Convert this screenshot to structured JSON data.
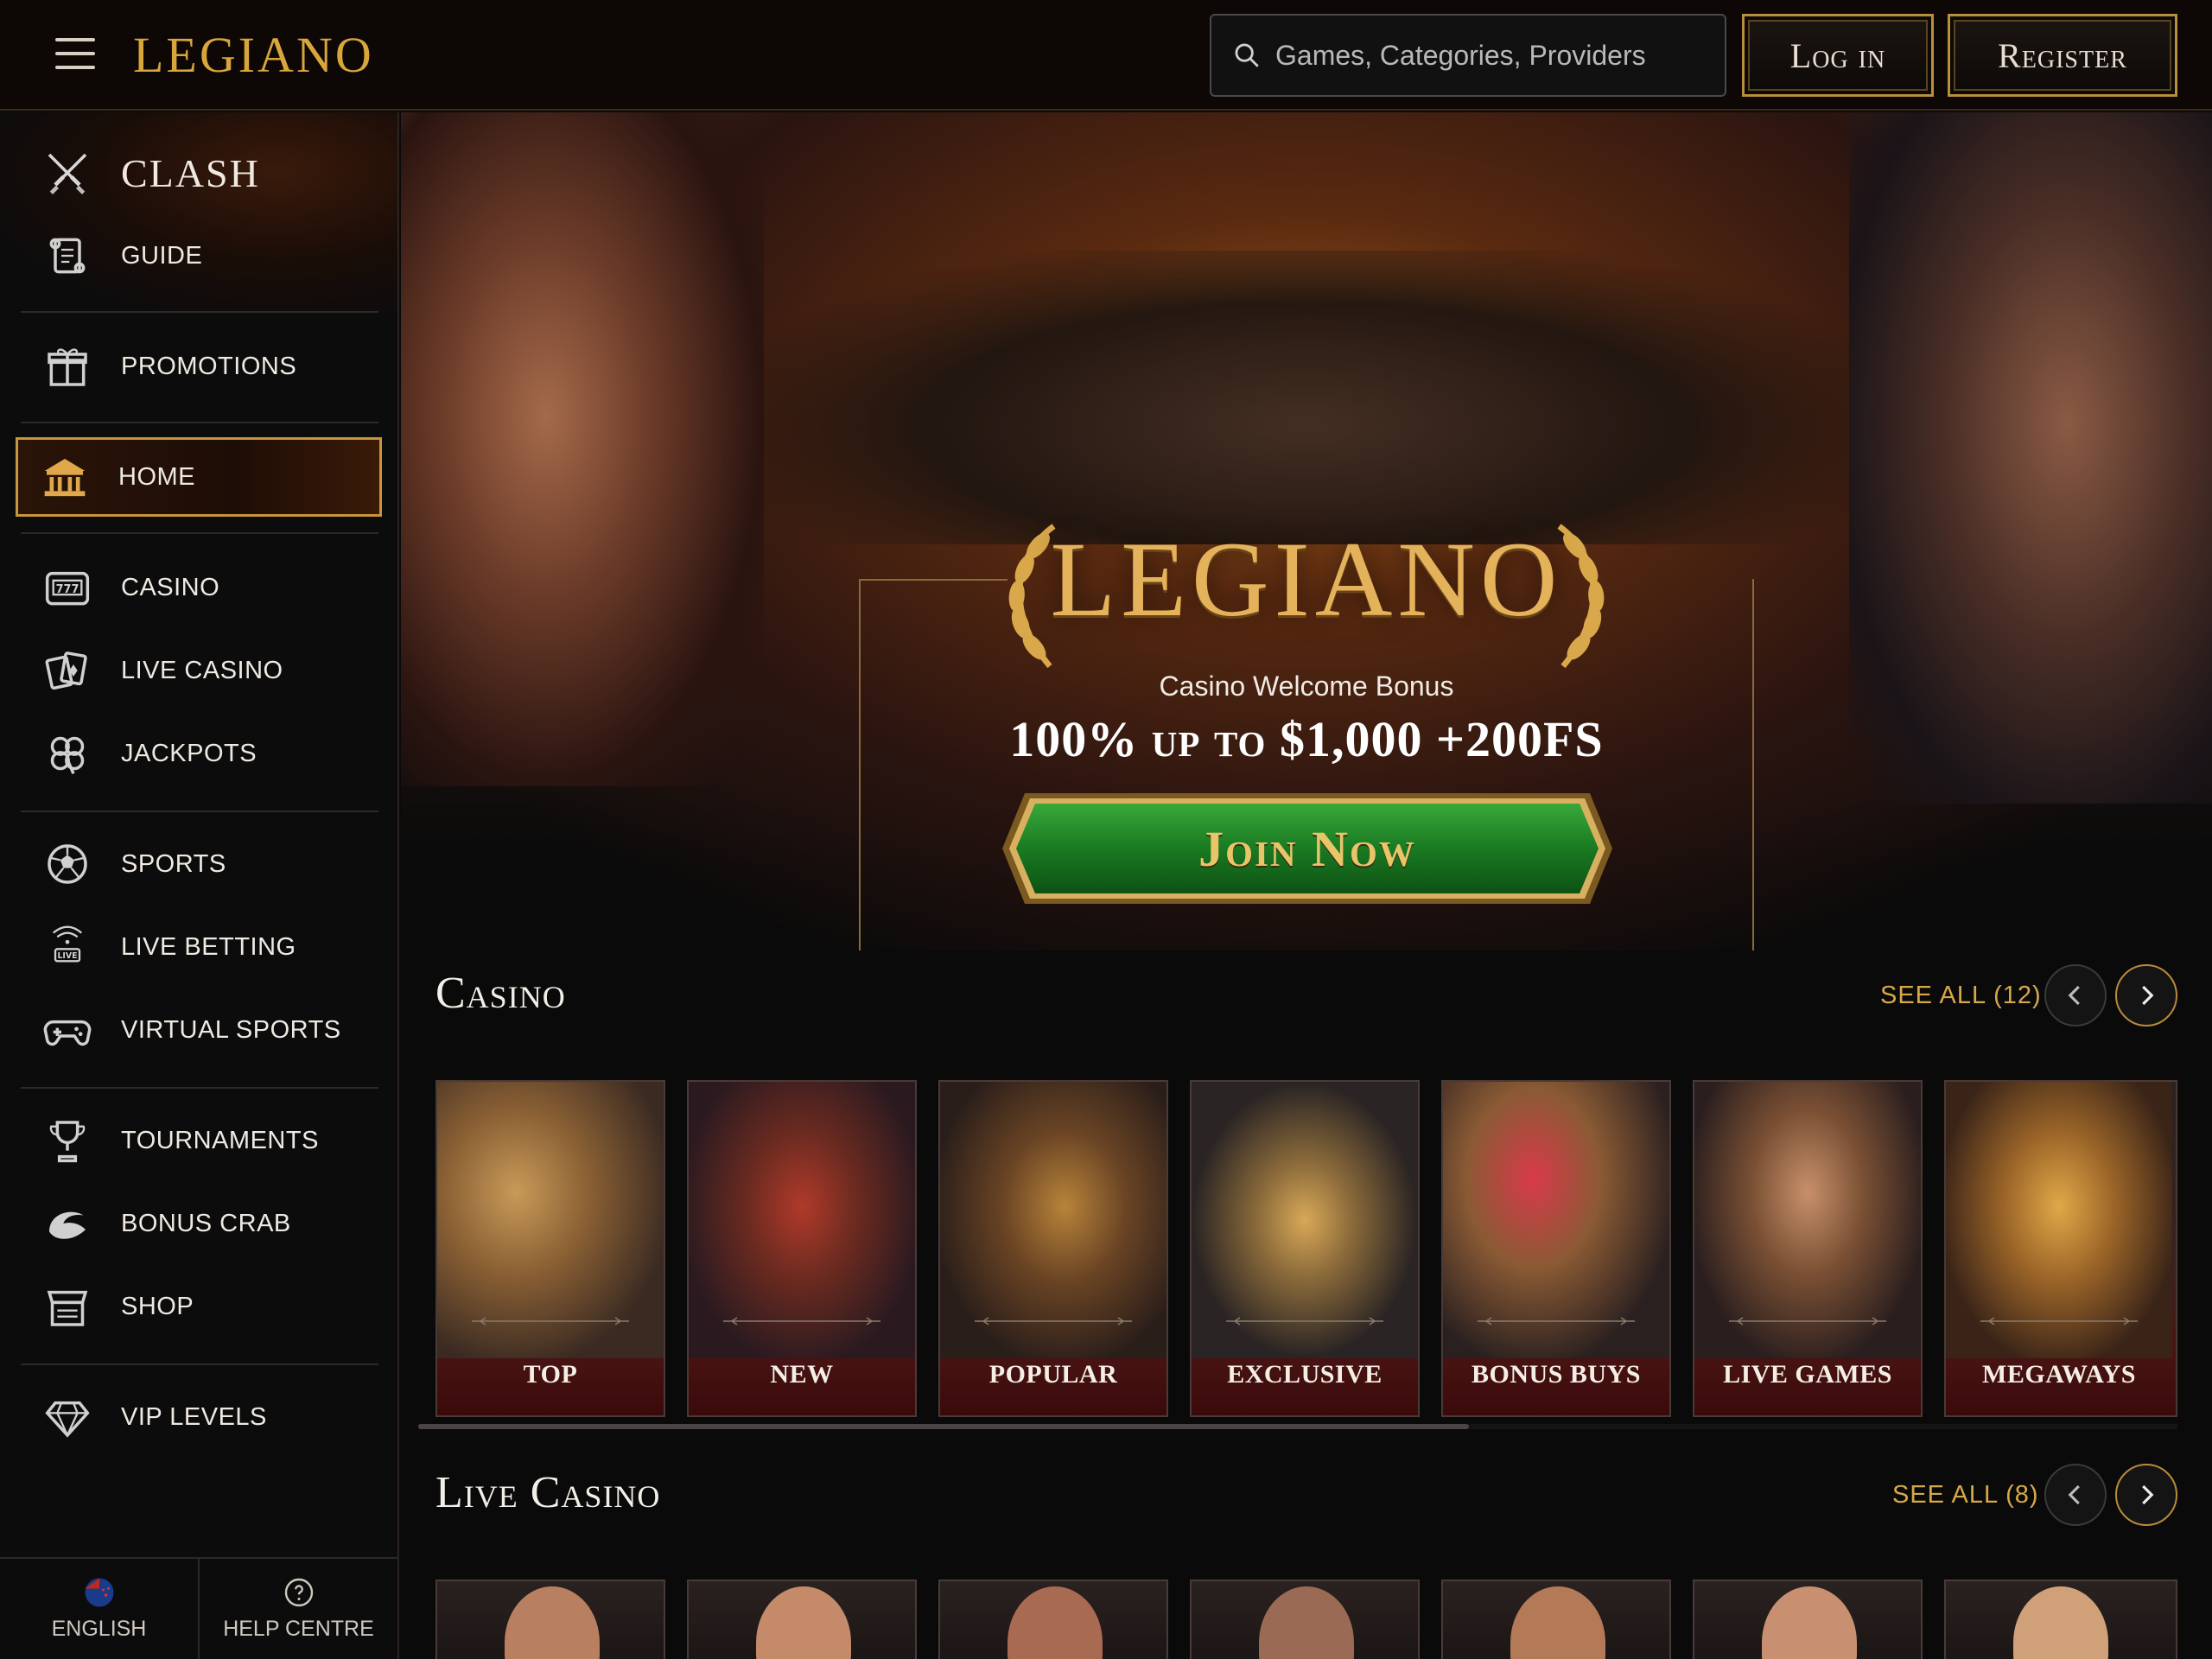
{
  "header": {
    "logo": "LEGIANO",
    "search_placeholder": "Games, Categories, Providers",
    "login_label": "Log in",
    "register_label": "Register"
  },
  "sidebar": {
    "clash": "CLASH",
    "guide": "GUIDE",
    "promotions": "PROMOTIONS",
    "home": "HOME",
    "casino": "CASINO",
    "live_casino": "LIVE CASINO",
    "jackpots": "JACKPOTS",
    "sports": "SPORTS",
    "live_betting": "LIVE BETTING",
    "virtual_sports": "VIRTUAL SPORTS",
    "tournaments": "TOURNAMENTS",
    "bonus_crab": "BONUS CRAB",
    "shop": "SHOP",
    "vip_levels": "VIP LEVELS",
    "language": "ENGLISH",
    "help": "HELP CENTRE"
  },
  "hero": {
    "logo": "LEGIANO",
    "subtitle": "Casino Welcome Bonus",
    "bonus": "100% up to $1,000 +200FS",
    "cta": "Join Now"
  },
  "casino_section": {
    "title": "Casino",
    "see_all": "SEE ALL (12)",
    "cards": [
      "TOP",
      "NEW",
      "POPULAR",
      "EXCLUSIVE",
      "BONUS BUYS",
      "LIVE GAMES",
      "MEGAWAYS"
    ]
  },
  "live_section": {
    "title": "Live Casino",
    "see_all": "SEE ALL (8)"
  },
  "colors": {
    "gold": "#d7a84a",
    "background": "#0a0a0a",
    "cta_green": "#1f8a2a"
  }
}
